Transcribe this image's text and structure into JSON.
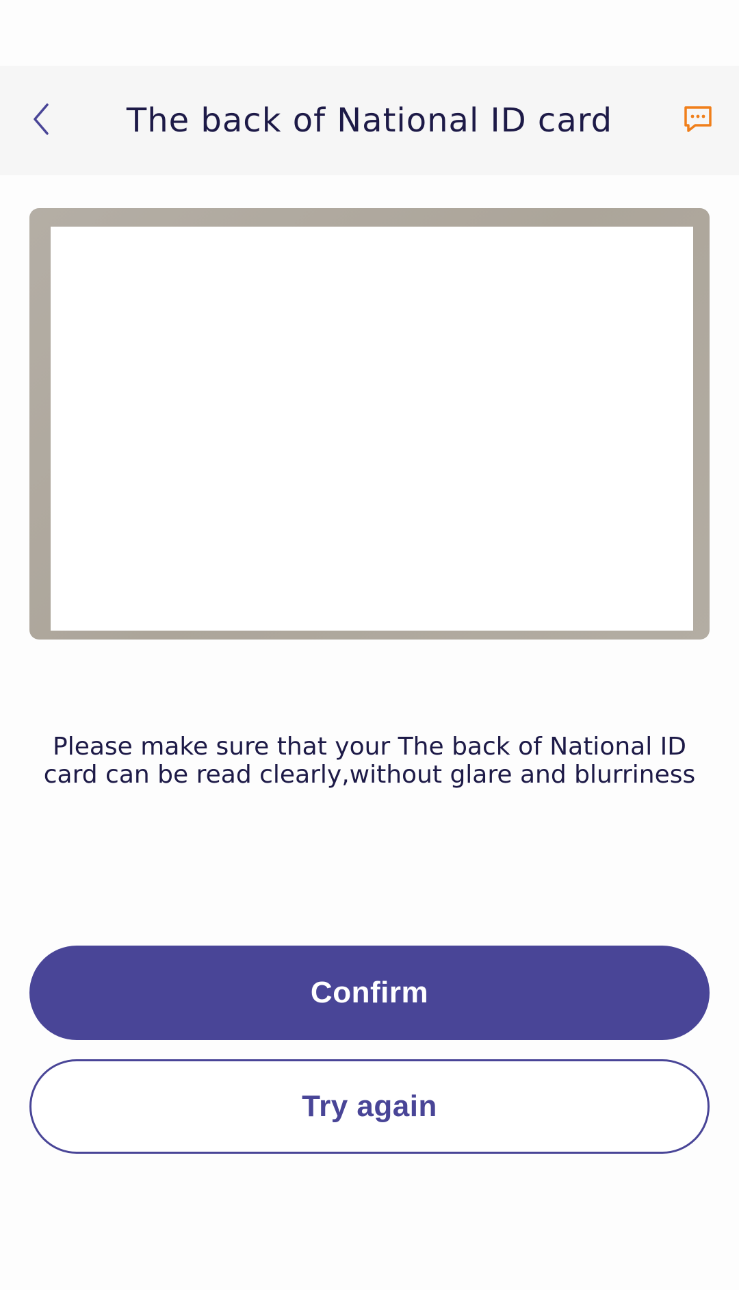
{
  "header": {
    "title": "The back of National ID card",
    "back_icon": "chevron-left-icon",
    "help_icon": "chat-bubble-icon"
  },
  "main": {
    "instruction": "Please make sure that your The back of National ID card can be read clearly,without glare and blurriness"
  },
  "actions": {
    "confirm_label": "Confirm",
    "retry_label": "Try again"
  },
  "colors": {
    "primary": "#494597",
    "accent_icon": "#f07f1a",
    "text": "#1d1a47",
    "header_bg": "#f6f6f6"
  }
}
